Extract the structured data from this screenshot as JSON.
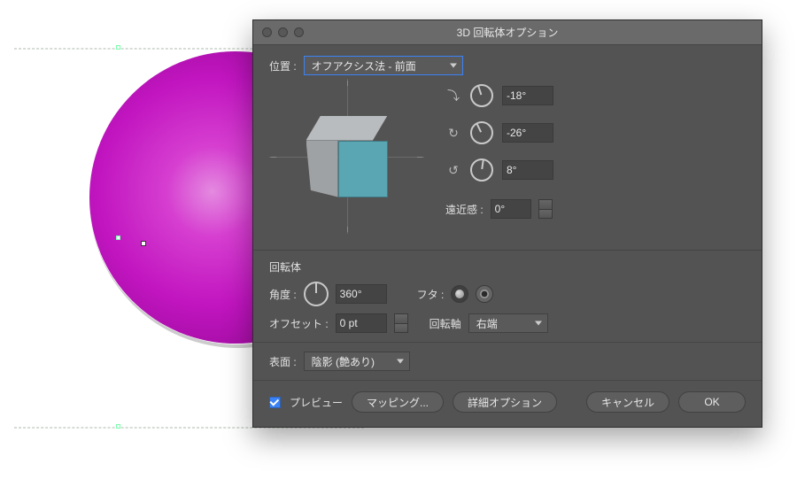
{
  "dialog": {
    "title": "3D 回転体オプション",
    "position": {
      "label": "位置 :",
      "value": "オフアクシス法 - 前面"
    },
    "rotation": {
      "x": "-18°",
      "y": "-26°",
      "z": "8°",
      "glyph_x": "⤵",
      "glyph_y": "↻",
      "glyph_z": "↺"
    },
    "perspective": {
      "label": "遠近感 :",
      "value": "0°"
    },
    "revolve": {
      "section_title": "回転体",
      "angle_label": "角度 :",
      "angle_value": "360°",
      "cap_label": "フタ :",
      "offset_label": "オフセット :",
      "offset_value": "0 pt",
      "axis_label": "回転軸",
      "axis_value": "右端"
    },
    "surface": {
      "label": "表面 :",
      "value": "陰影 (艶あり)"
    },
    "footer": {
      "preview": "プレビュー",
      "mapping": "マッピング...",
      "advanced": "詳細オプション",
      "cancel": "キャンセル",
      "ok": "OK"
    }
  },
  "colors": {
    "accent": "#3b82f6",
    "sphere": "#c115c0"
  }
}
